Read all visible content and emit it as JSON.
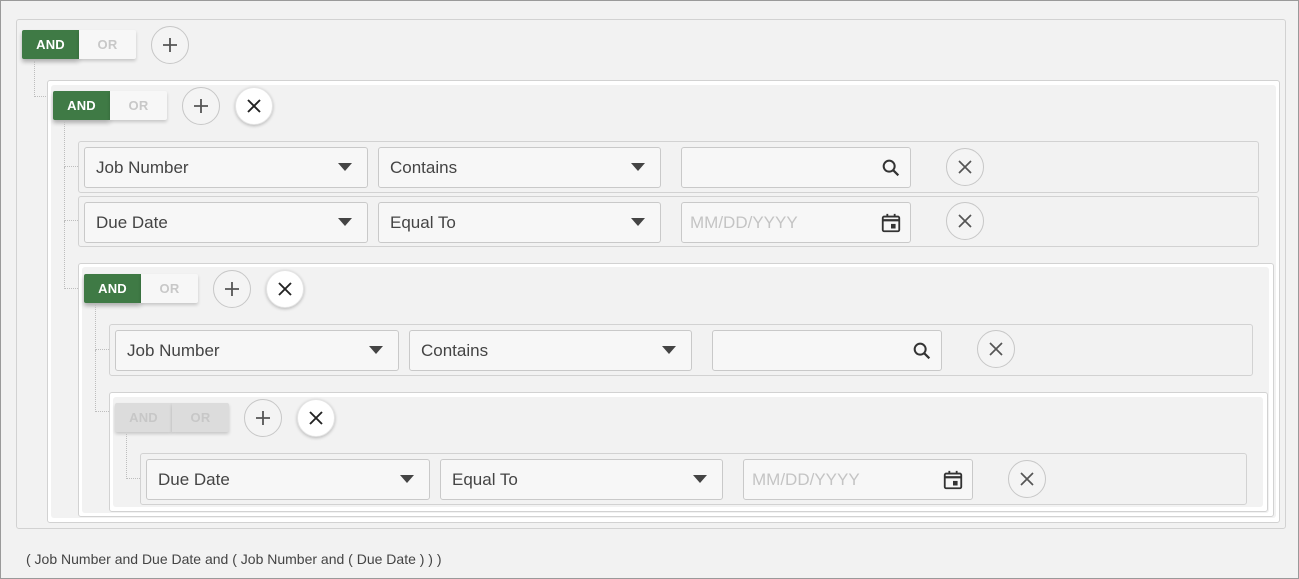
{
  "logic": {
    "and_label": "AND",
    "or_label": "OR"
  },
  "icons": {
    "add": "plus-icon",
    "delete_group": "close-icon",
    "remove_rule": "circle-close-icon",
    "search": "search-icon",
    "calendar": "calendar-icon"
  },
  "colors": {
    "active_toggle": "#3f7a45",
    "inactive_toggle": "#f7f7f7"
  },
  "rules": {
    "r1": {
      "field": "Job Number",
      "operator": "Contains",
      "value": "",
      "placeholder": ""
    },
    "r2": {
      "field": "Due Date",
      "operator": "Equal To",
      "value": "",
      "placeholder": "MM/DD/YYYY"
    },
    "r3": {
      "field": "Job Number",
      "operator": "Contains",
      "value": "",
      "placeholder": ""
    },
    "r4": {
      "field": "Due Date",
      "operator": "Equal To",
      "value": "",
      "placeholder": "MM/DD/YYYY"
    }
  },
  "summary": "( Job Number and Due Date and ( Job Number and ( Due Date ) ) )"
}
